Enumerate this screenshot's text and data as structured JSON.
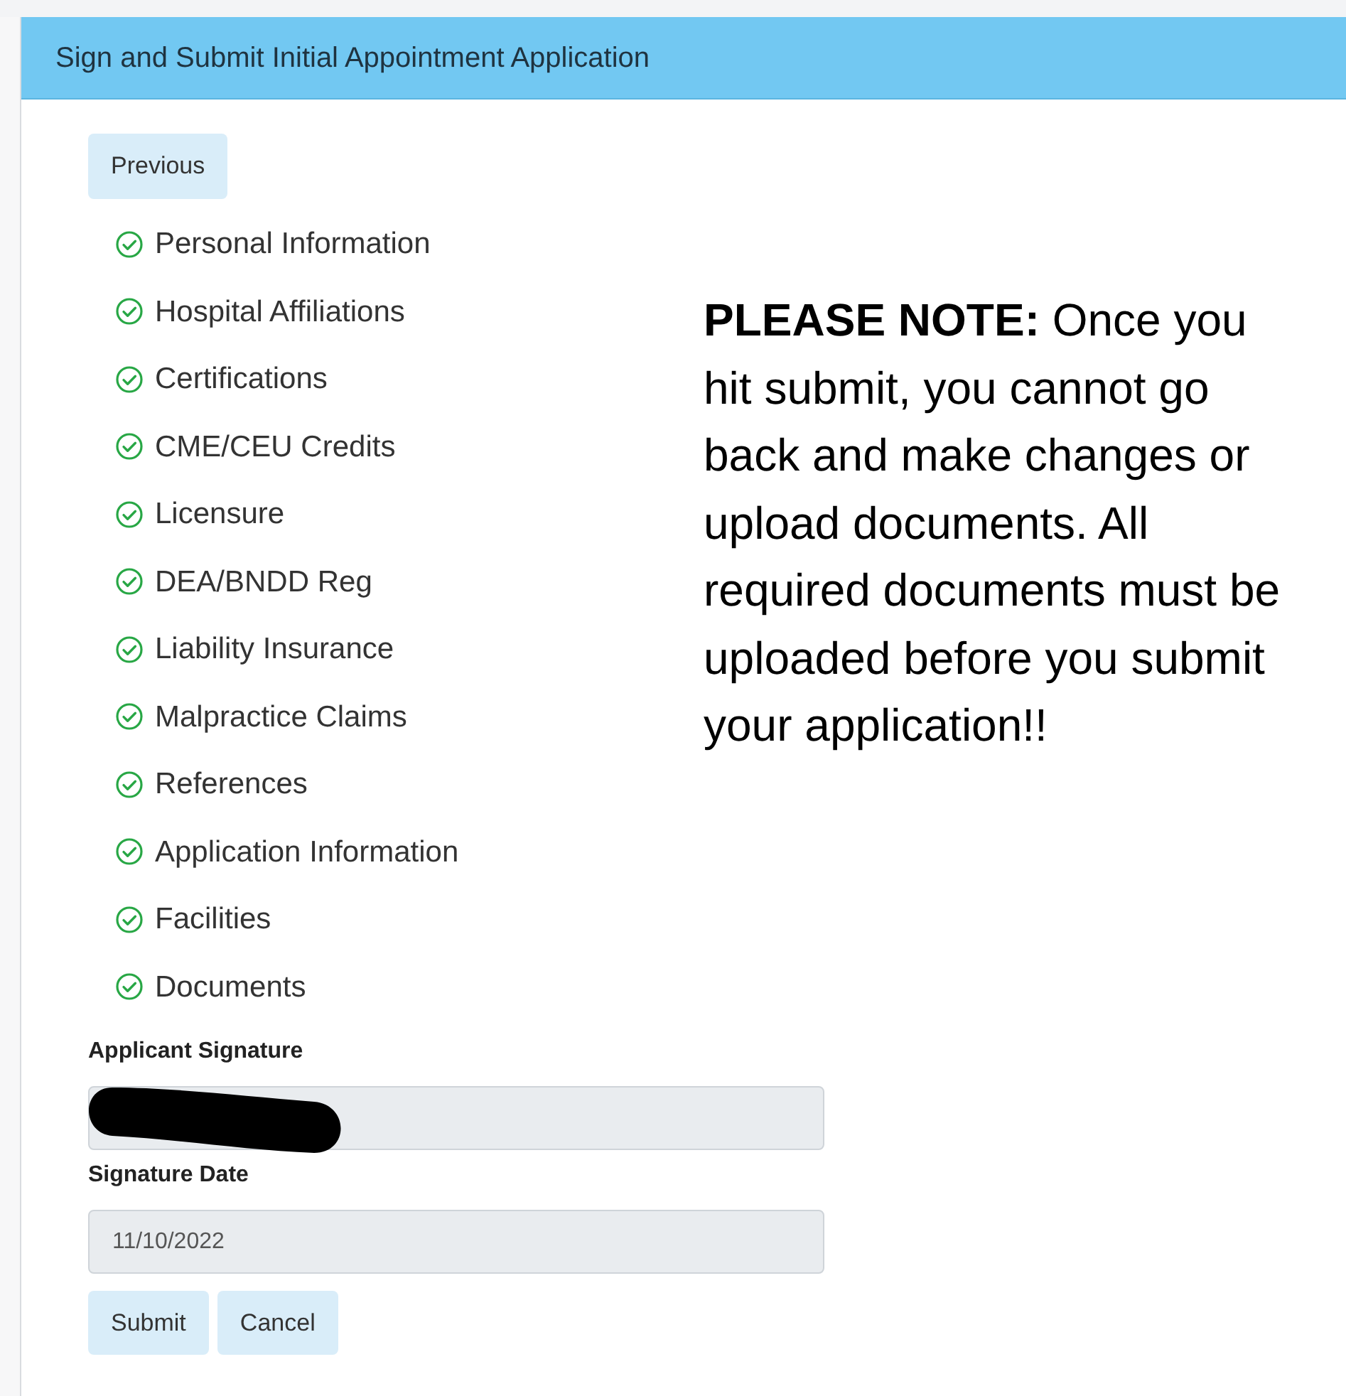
{
  "panel": {
    "title": "Sign and Submit Initial Appointment Application"
  },
  "previous_button": "Previous",
  "steps": [
    {
      "label": "Personal Information",
      "done": true
    },
    {
      "label": "Hospital Affiliations",
      "done": true
    },
    {
      "label": "Certifications",
      "done": true
    },
    {
      "label": "CME/CEU Credits",
      "done": true
    },
    {
      "label": "Licensure",
      "done": true
    },
    {
      "label": "DEA/BNDD Reg",
      "done": true
    },
    {
      "label": "Liability Insurance",
      "done": true
    },
    {
      "label": "Malpractice Claims",
      "done": true
    },
    {
      "label": "References",
      "done": true
    },
    {
      "label": "Application Information",
      "done": true
    },
    {
      "label": "Facilities",
      "done": true
    },
    {
      "label": "Documents",
      "done": true
    }
  ],
  "fields": [
    {
      "label": "Applicant Signature",
      "redacted": true
    },
    {
      "label": "Signature Date",
      "value": "11/10/2022",
      "redacted": false
    }
  ],
  "buttons": [
    "Submit",
    "Cancel"
  ],
  "note": "**PLEASE NOTE:**  Once you hit submit, you cannot go back and make changes or upload documents.  All required documents must be uploaded before you submit your application!!"
}
